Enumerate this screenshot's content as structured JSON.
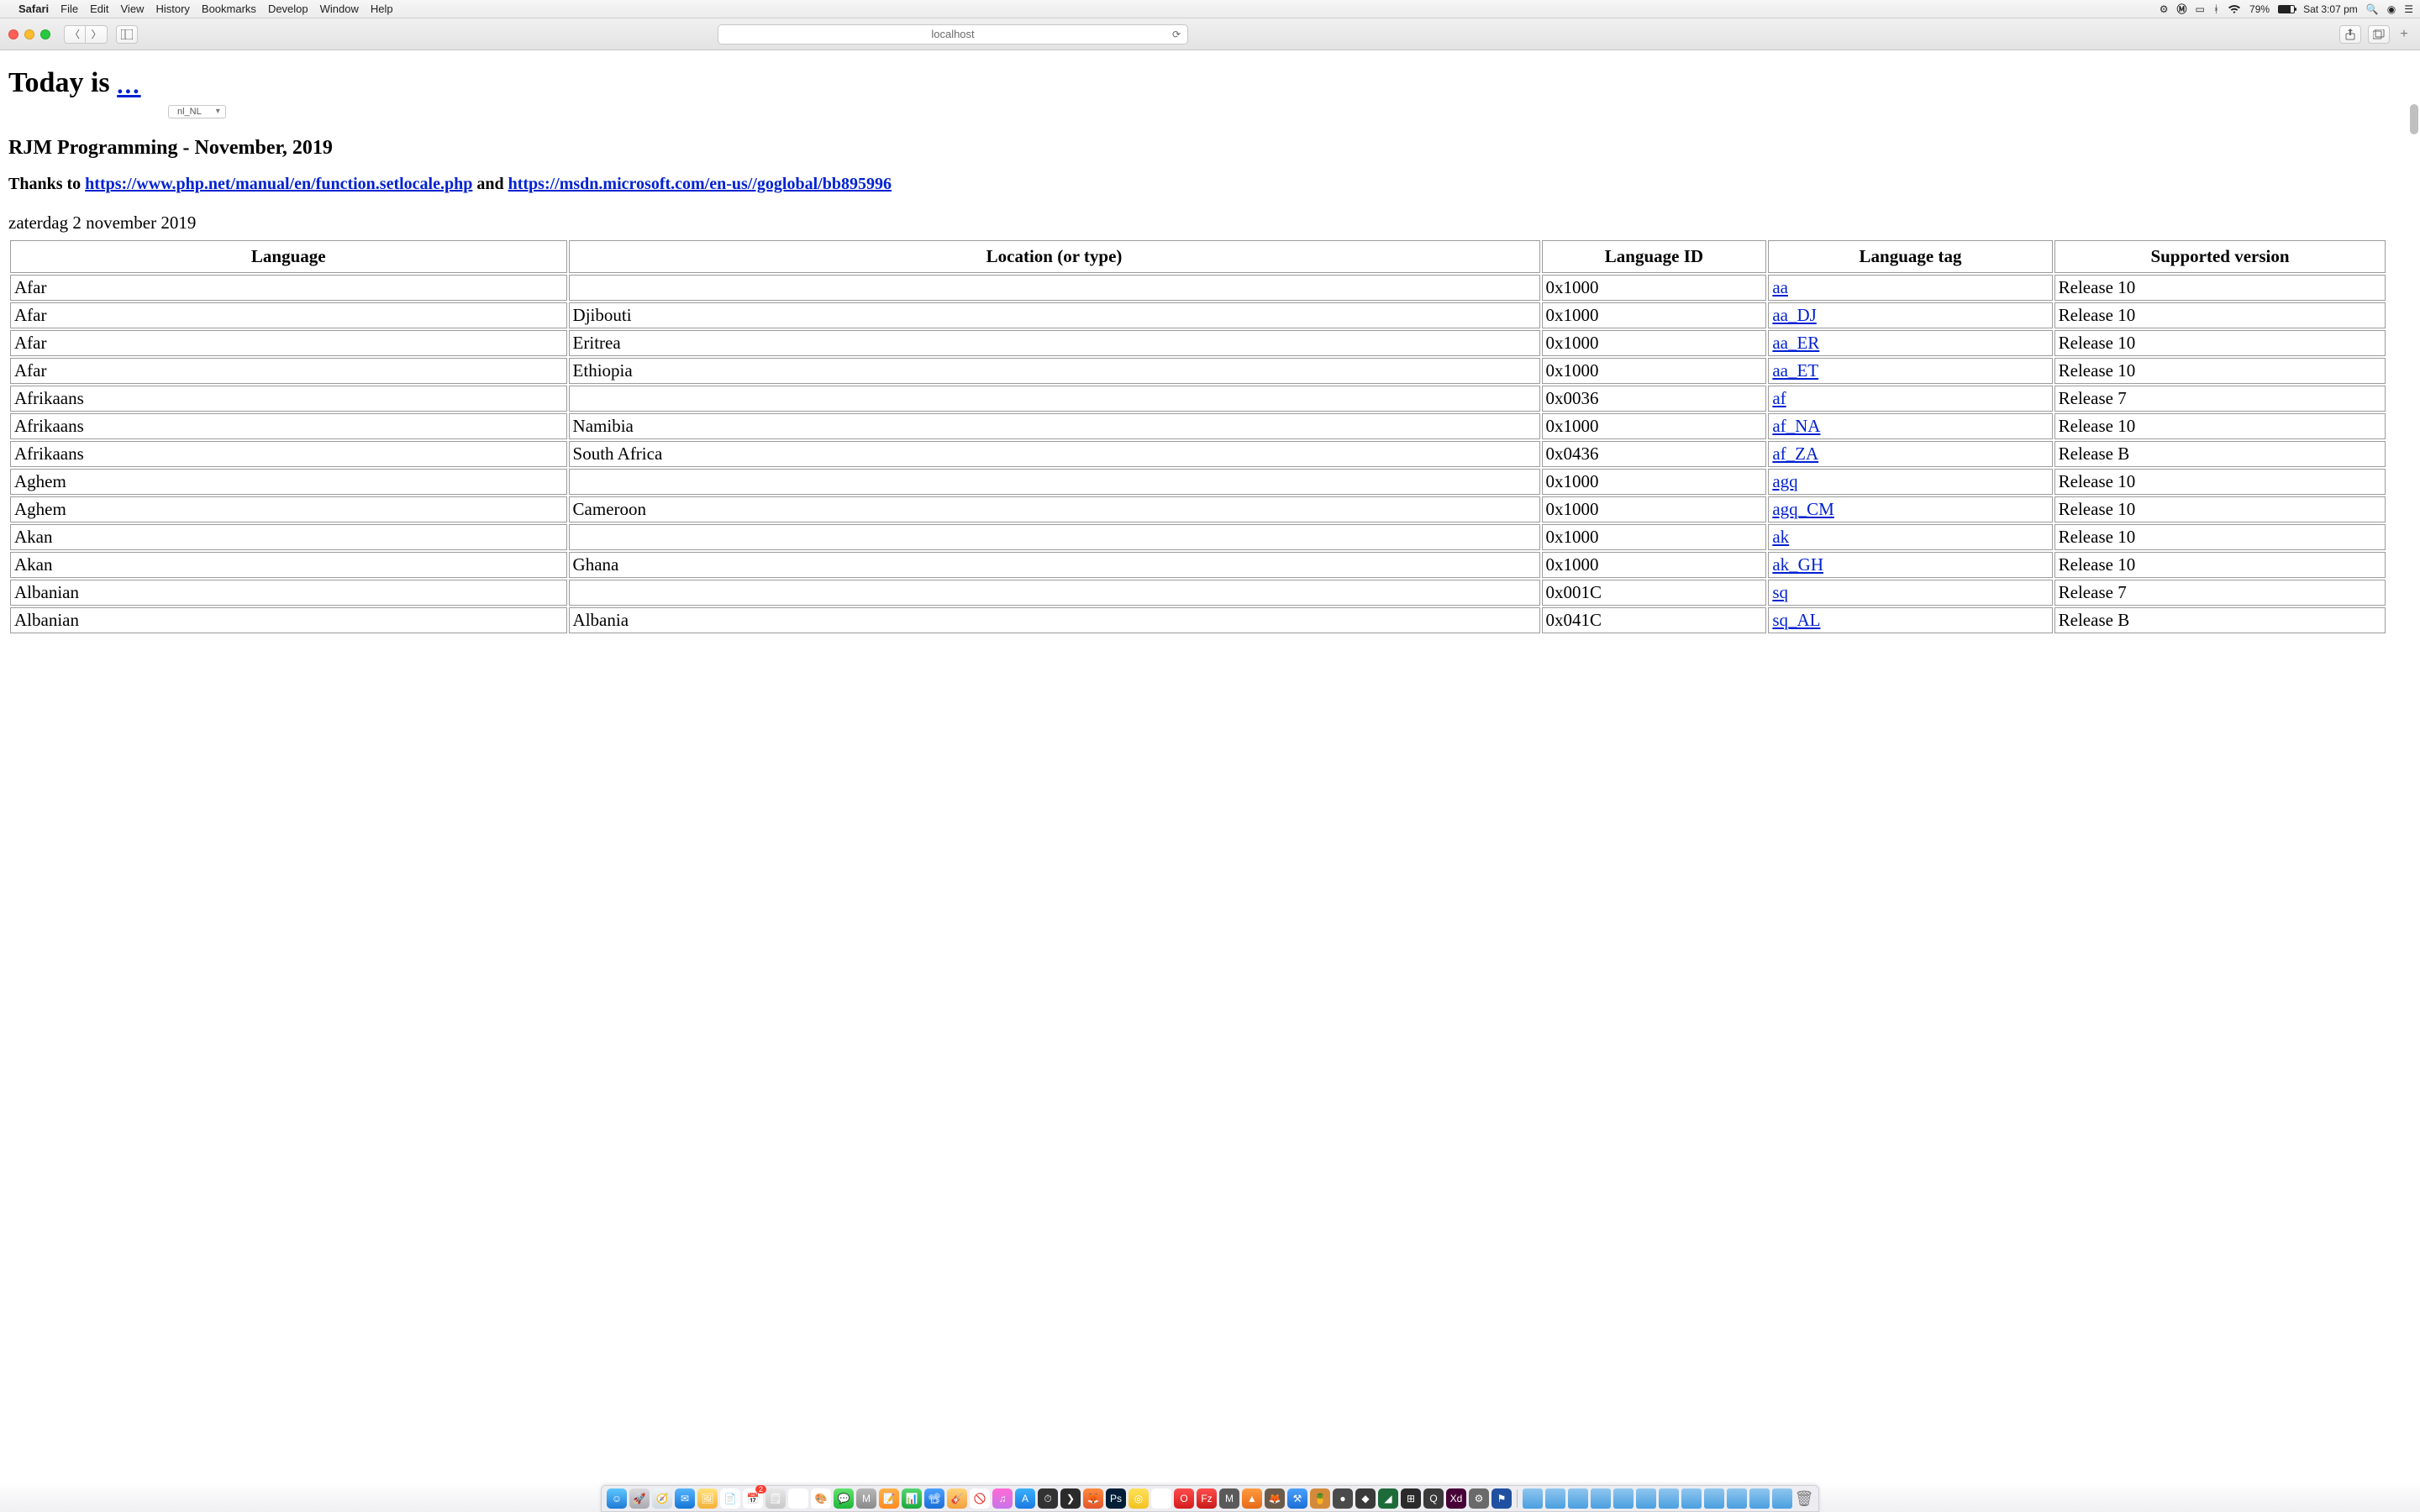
{
  "menubar": {
    "app": "Safari",
    "items": [
      "File",
      "Edit",
      "View",
      "History",
      "Bookmarks",
      "Develop",
      "Window",
      "Help"
    ],
    "battery_pct": "79%",
    "clock": "Sat 3:07 pm"
  },
  "toolbar": {
    "address": "localhost"
  },
  "page": {
    "title_prefix": "Today is ",
    "title_dots": "...",
    "locale_select_value": "nl_NL",
    "subtitle": "RJM Programming - November, 2019",
    "credits_prefix": "Thanks to ",
    "credits_link1_text": "https://www.php.net/manual/en/function.setlocale.php",
    "credits_mid": " and ",
    "credits_link2_text": "https://msdn.microsoft.com/en-us//goglobal/bb895996",
    "date_string": "zaterdag 2 november 2019",
    "table": {
      "headers": [
        "Language",
        "Location (or type)",
        "Language ID",
        "Language tag",
        "Supported version"
      ],
      "rows": [
        {
          "lang": "Afar",
          "loc": "",
          "id": "0x1000",
          "tag": "aa",
          "tag_link": true,
          "ver": "Release 10"
        },
        {
          "lang": "Afar",
          "loc": "Djibouti",
          "id": "0x1000",
          "tag": "aa_DJ",
          "tag_link": true,
          "ver": "Release 10"
        },
        {
          "lang": "Afar",
          "loc": "Eritrea",
          "id": "0x1000",
          "tag": "aa_ER",
          "tag_link": true,
          "ver": "Release 10"
        },
        {
          "lang": "Afar",
          "loc": "Ethiopia",
          "id": "0x1000",
          "tag": "aa_ET",
          "tag_link": true,
          "ver": "Release 10"
        },
        {
          "lang": "Afrikaans",
          "loc": "",
          "id": "0x0036",
          "tag": "af",
          "tag_link": true,
          "ver": "Release 7"
        },
        {
          "lang": "Afrikaans",
          "loc": "Namibia",
          "id": "0x1000",
          "tag": "af_NA",
          "tag_link": true,
          "ver": "Release 10"
        },
        {
          "lang": "Afrikaans",
          "loc": "South Africa",
          "id": "0x0436",
          "tag": "af_ZA",
          "tag_link": true,
          "ver": "Release B"
        },
        {
          "lang": "Aghem",
          "loc": "",
          "id": "0x1000",
          "tag": "agq",
          "tag_link": true,
          "ver": "Release 10"
        },
        {
          "lang": "Aghem",
          "loc": "Cameroon",
          "id": "0x1000",
          "tag": "agq_CM",
          "tag_link": true,
          "ver": "Release 10"
        },
        {
          "lang": "Akan",
          "loc": "",
          "id": "0x1000",
          "tag": "ak",
          "tag_link": true,
          "ver": "Release 10"
        },
        {
          "lang": "Akan",
          "loc": "Ghana",
          "id": "0x1000",
          "tag": "ak_GH",
          "tag_link": true,
          "ver": "Release 10"
        },
        {
          "lang": "Albanian",
          "loc": "",
          "id": "0x001C",
          "tag": "sq",
          "tag_link": true,
          "ver": "Release 7"
        },
        {
          "lang": "Albanian",
          "loc": "Albania",
          "id": "0x041C",
          "tag": "sq_AL",
          "tag_link": true,
          "ver": "Release B"
        }
      ]
    }
  },
  "dock": {
    "apps": [
      {
        "name": "finder",
        "bg": "linear-gradient(#5ec6ff,#1e7ad6)",
        "glyph": "☺"
      },
      {
        "name": "launchpad",
        "bg": "linear-gradient(#d9d9de,#a9a9b0)",
        "glyph": "🚀"
      },
      {
        "name": "safari",
        "bg": "linear-gradient(#eef3f8,#cfd8e2)",
        "glyph": "🧭"
      },
      {
        "name": "mail",
        "bg": "linear-gradient(#56b3ff,#1476d6)",
        "glyph": "✉"
      },
      {
        "name": "iphoto",
        "bg": "linear-gradient(#ffe27a,#f3b13a)",
        "glyph": "🖼"
      },
      {
        "name": "textedit",
        "bg": "#ffffff",
        "glyph": "📄"
      },
      {
        "name": "calendar",
        "bg": "#ffffff",
        "glyph": "📅",
        "badge": "2"
      },
      {
        "name": "preview",
        "bg": "linear-gradient(#e8e8e8,#c8c8c8)",
        "glyph": "🗒"
      },
      {
        "name": "paintbrush",
        "bg": "#ffffff",
        "glyph": "🖌"
      },
      {
        "name": "colorsync",
        "bg": "#ffffff",
        "glyph": "🎨"
      },
      {
        "name": "messages",
        "bg": "linear-gradient(#62e36e,#1fb53a)",
        "glyph": "💬"
      },
      {
        "name": "mamp",
        "bg": "linear-gradient(#b7b7b7,#8a8a8a)",
        "glyph": "M"
      },
      {
        "name": "pages",
        "bg": "linear-gradient(#ffb24a,#ff8a1f)",
        "glyph": "📝"
      },
      {
        "name": "numbers",
        "bg": "linear-gradient(#54d66e,#1ea83e)",
        "glyph": "📊"
      },
      {
        "name": "keynote",
        "bg": "linear-gradient(#4aa0ff,#1b6fd6)",
        "glyph": "📽"
      },
      {
        "name": "garageband",
        "bg": "linear-gradient(#ffd27a,#f3a13a)",
        "glyph": "🎸"
      },
      {
        "name": "nosign",
        "bg": "#ffffff",
        "glyph": "🚫"
      },
      {
        "name": "itunes",
        "bg": "linear-gradient(#ff6ad5,#c774e8)",
        "glyph": "♫"
      },
      {
        "name": "appstore",
        "bg": "linear-gradient(#3ab0ff,#1a7ae0)",
        "glyph": "A"
      },
      {
        "name": "activity",
        "bg": "#333333",
        "glyph": "⏱"
      },
      {
        "name": "terminal",
        "bg": "#2b2b2b",
        "glyph": "❯"
      },
      {
        "name": "firefox",
        "bg": "linear-gradient(#ff8a3d,#e2552c)",
        "glyph": "🦊"
      },
      {
        "name": "photoshop",
        "bg": "#001e36",
        "glyph": "Ps"
      },
      {
        "name": "chrome-canary",
        "bg": "linear-gradient(#ffe15a,#f3c21f)",
        "glyph": "◎"
      },
      {
        "name": "chrome",
        "bg": "#ffffff",
        "glyph": "◎"
      },
      {
        "name": "opera",
        "bg": "linear-gradient(#ff4b4b,#d41d1d)",
        "glyph": "O"
      },
      {
        "name": "filezilla",
        "bg": "linear-gradient(#ff4b4b,#c81a1a)",
        "glyph": "Fz"
      },
      {
        "name": "mamp-pro",
        "bg": "#5a5a5a",
        "glyph": "M"
      },
      {
        "name": "vlc",
        "bg": "linear-gradient(#ff9a3d,#e66a1a)",
        "glyph": "▲"
      },
      {
        "name": "gimp",
        "bg": "#6b5b4b",
        "glyph": "🦊"
      },
      {
        "name": "xcode",
        "bg": "linear-gradient(#4aa0ff,#1b6fd6)",
        "glyph": "⚒"
      },
      {
        "name": "handbrake",
        "bg": "#d48a3a",
        "glyph": "🍍"
      },
      {
        "name": "unknown1",
        "bg": "#4a4a4a",
        "glyph": "●"
      },
      {
        "name": "unknown2",
        "bg": "#3a3a3a",
        "glyph": "◆"
      },
      {
        "name": "android-studio",
        "bg": "#1e6b3a",
        "glyph": "◢"
      },
      {
        "name": "dashboard",
        "bg": "#2b2b2b",
        "glyph": "⊞"
      },
      {
        "name": "quicktime",
        "bg": "#3a3a3a",
        "glyph": "Q"
      },
      {
        "name": "xd",
        "bg": "#470137",
        "glyph": "Xd"
      },
      {
        "name": "systemprefs",
        "bg": "#6a6a6a",
        "glyph": "⚙"
      },
      {
        "name": "flag",
        "bg": "#2050a0",
        "glyph": "⚑"
      }
    ],
    "folders_count": 12
  }
}
